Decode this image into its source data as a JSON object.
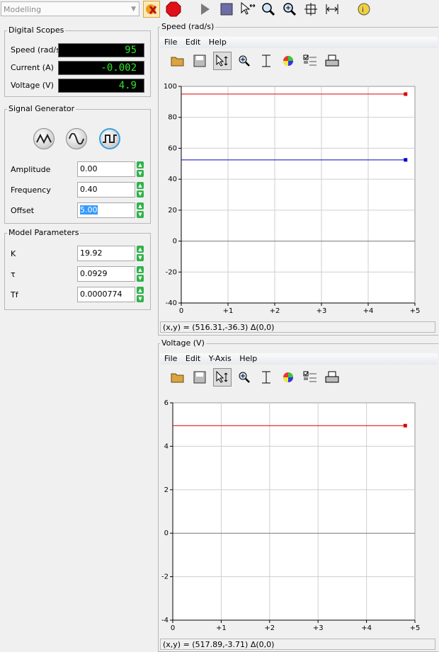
{
  "toolbar": {
    "mode_select": "Modelling",
    "icons": [
      "reset-icon",
      "stop-icon",
      "play-icon",
      "pause-icon",
      "select-move-icon",
      "zoom-icon",
      "zoom-fit-icon",
      "autoscale-icon",
      "fit-width-icon",
      "info-icon"
    ]
  },
  "scopes": {
    "title": "Digital Scopes",
    "rows": [
      {
        "label": "Speed (rad/s)",
        "value": "95"
      },
      {
        "label": "Current (A)",
        "value": "-0.002"
      },
      {
        "label": "Voltage (V)",
        "value": "4.9"
      }
    ]
  },
  "siggen": {
    "title": "Signal Generator",
    "waves": [
      "triangle-wave-icon",
      "sine-wave-icon",
      "square-wave-icon"
    ],
    "selected_wave": "square-wave-icon",
    "rows": [
      {
        "label": "Amplitude",
        "value": "0.00"
      },
      {
        "label": "Frequency",
        "value": "0.40"
      },
      {
        "label": "Offset",
        "value": "5.00"
      }
    ]
  },
  "model": {
    "title": "Model Parameters",
    "rows": [
      {
        "label": "K",
        "value": "19.92"
      },
      {
        "label": "τ",
        "value": "0.0929"
      },
      {
        "label": "Tf",
        "value": "0.0000774"
      }
    ]
  },
  "speed_panel": {
    "title": "Speed (rad/s)",
    "menu": [
      "File",
      "Edit",
      "Help"
    ],
    "status": "(x,y) = (516.31,-36.3) Δ(0,0)"
  },
  "voltage_panel": {
    "title": "Voltage (V)",
    "menu": [
      "File",
      "Edit",
      "Y-Axis",
      "Help"
    ],
    "status": "(x,y) = (517.89,-3.71) Δ(0,0)"
  },
  "chart_data": [
    {
      "type": "line",
      "title": "Speed (rad/s)",
      "x_ticks": [
        "0",
        "+1",
        "+2",
        "+3",
        "+4",
        "+5"
      ],
      "y_ticks": [
        "-40",
        "-20",
        "0",
        "20",
        "40",
        "60",
        "80",
        "100"
      ],
      "xlim": [
        0,
        5
      ],
      "ylim": [
        -40,
        100
      ],
      "grid": true,
      "series": [
        {
          "color": "#dd0000",
          "x": [
            0,
            4.8
          ],
          "y": [
            95,
            95
          ]
        },
        {
          "color": "#0000cc",
          "x": [
            0,
            4.8
          ],
          "y": [
            52.5,
            52.5
          ]
        }
      ]
    },
    {
      "type": "line",
      "title": "Voltage (V)",
      "x_ticks": [
        "0",
        "+1",
        "+2",
        "+3",
        "+4",
        "+5"
      ],
      "y_ticks": [
        "-4",
        "-2",
        "0",
        "2",
        "4",
        "6"
      ],
      "xlim": [
        0,
        5
      ],
      "ylim": [
        -4,
        6
      ],
      "grid": true,
      "series": [
        {
          "color": "#dd0000",
          "x": [
            0,
            4.8
          ],
          "y": [
            4.95,
            4.95
          ]
        }
      ]
    }
  ]
}
